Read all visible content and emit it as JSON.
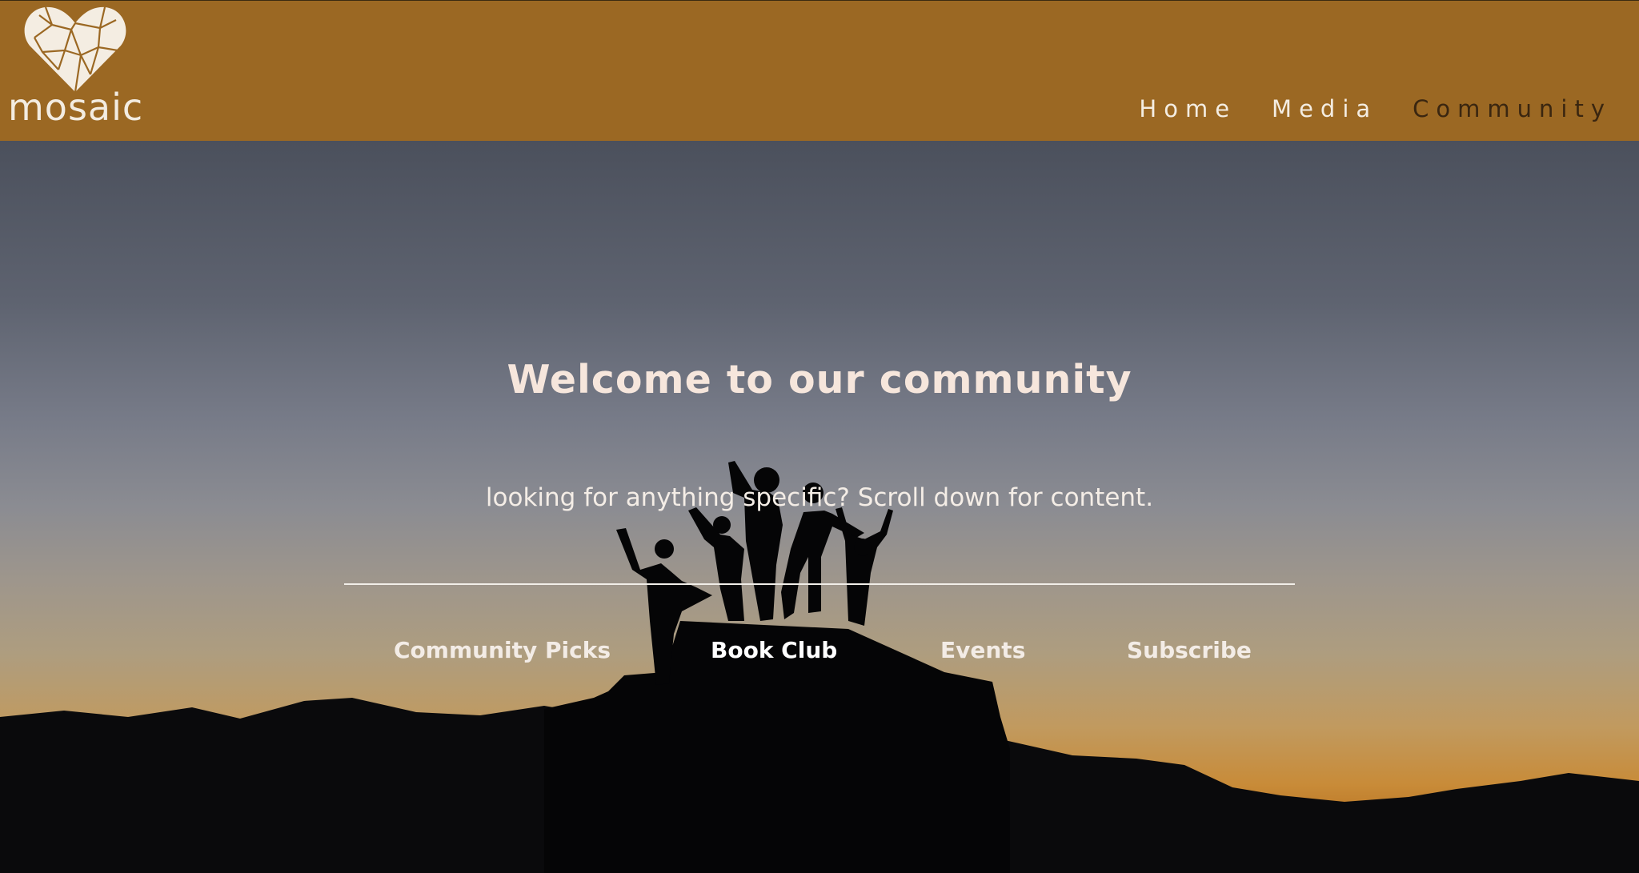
{
  "header": {
    "logo": {
      "text": "mosaic",
      "icon": "mosaic-heart-icon"
    },
    "nav": [
      {
        "label": "Home"
      },
      {
        "label": "Media"
      },
      {
        "label": "Community"
      }
    ]
  },
  "hero": {
    "title": "Welcome to our community",
    "subtitle": "looking for anything specific? Scroll down for content.",
    "links": [
      {
        "label": "Community Picks"
      },
      {
        "label": "Book Club"
      },
      {
        "label": "Events"
      },
      {
        "label": "Subscribe"
      }
    ]
  },
  "colors": {
    "header_bg": "#9b6823",
    "text_light": "#f4ede2",
    "active_nav": "#3a2610"
  }
}
